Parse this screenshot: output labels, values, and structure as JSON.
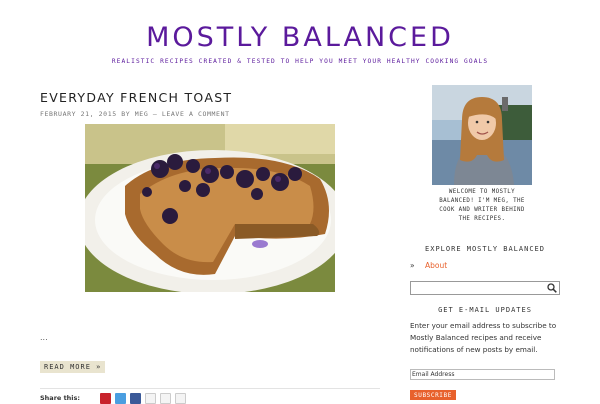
{
  "header": {
    "site_title": "MOSTLY BALANCED",
    "tagline": "REALISTIC RECIPES CREATED & TESTED TO HELP YOU MEET YOUR HEALTHY COOKING GOALS"
  },
  "post": {
    "title": "EVERYDAY FRENCH TOAST",
    "date": "FEBRUARY 21, 2015",
    "by": "BY",
    "author": "MEG",
    "separator": "—",
    "comment_link": "LEAVE A COMMENT",
    "excerpt": "...",
    "read_more": "READ MORE »",
    "share_label": "Share this:"
  },
  "sidebar": {
    "welcome": "WELCOME TO MOSTLY BALANCED! I'M MEG, THE COOK AND WRITER BEHIND THE RECIPES.",
    "explore_title": "EXPLORE MOSTLY BALANCED",
    "about_bullet": "»",
    "about_link": "About",
    "email_title": "GET E-MAIL UPDATES",
    "email_desc": "Enter your email address to subscribe to Mostly Balanced recipes and receive notifications of new posts by email.",
    "email_placeholder": "Email Address",
    "subscribe_label": "SUBSCRIBE"
  },
  "colors": {
    "brand": "#5b1a9c",
    "link_accent": "#e8612c",
    "button_bg": "#e9e4cf"
  },
  "icons": [
    "pinterest-icon",
    "twitter-icon",
    "facebook-icon",
    "email-icon",
    "print-icon",
    "reddit-icon",
    "search-icon"
  ]
}
